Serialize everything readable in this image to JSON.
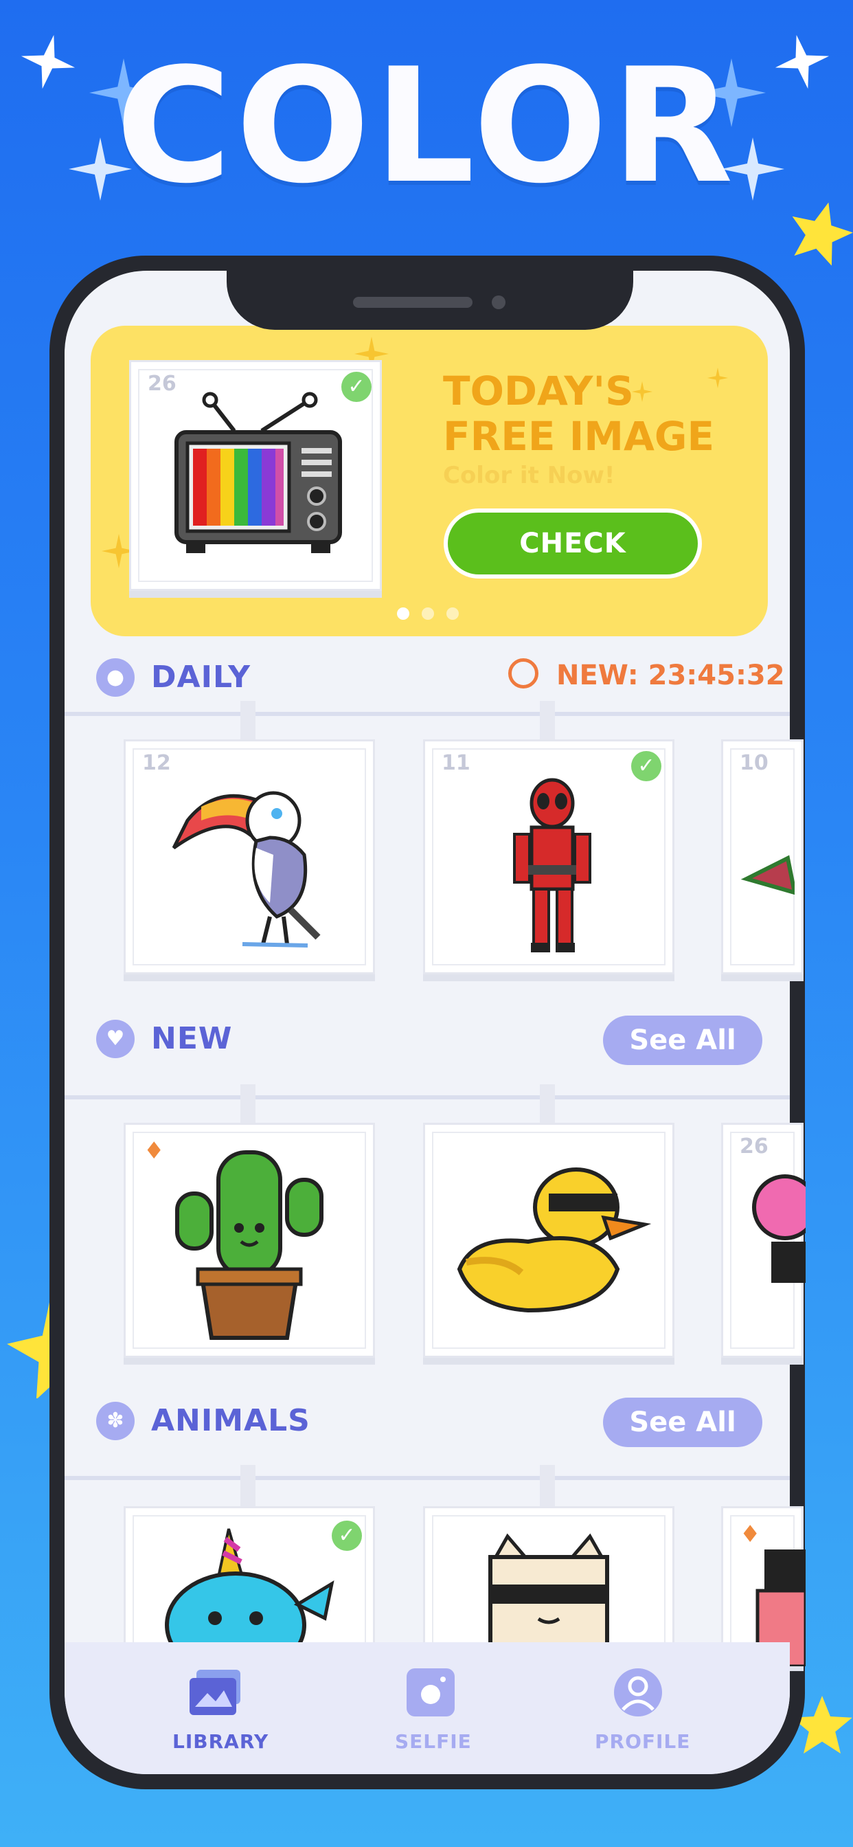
{
  "hero": {
    "title": "COLOR"
  },
  "banner": {
    "image_number": "26",
    "title_line1": "TODAY'S",
    "title_line2": "FREE IMAGE",
    "subtitle": "Color it Now!",
    "check_label": "CHECK",
    "page_dots": 3,
    "active_dot": 1
  },
  "daily": {
    "title": "DAILY",
    "timer": "NEW: 23:45:32",
    "cards": [
      {
        "num": "12",
        "subject": "toucan",
        "completed": false
      },
      {
        "num": "11",
        "subject": "deadpool",
        "completed": true
      },
      {
        "num": "10",
        "subject": "watermelon",
        "completed": false
      }
    ]
  },
  "new_section": {
    "title": "NEW",
    "see_all": "See All",
    "cards": [
      {
        "num": "",
        "subject": "cactus",
        "hot": true
      },
      {
        "num": "",
        "subject": "duck",
        "hot": false
      },
      {
        "num": "26",
        "subject": "flower",
        "hot": false
      }
    ]
  },
  "animals": {
    "title": "ANIMALS",
    "see_all": "See All",
    "cards": [
      {
        "subject": "narwhal",
        "completed": true
      },
      {
        "subject": "cat-with-sunglasses",
        "completed": false
      },
      {
        "subject": "partial",
        "hot": true
      }
    ]
  },
  "tabs": [
    {
      "label": "LIBRARY",
      "icon": "library-icon",
      "active": true
    },
    {
      "label": "SELFIE",
      "icon": "camera-icon",
      "active": false
    },
    {
      "label": "PROFILE",
      "icon": "profile-icon",
      "active": false
    }
  ],
  "colors": {
    "accent": "#5b63d6",
    "accent_light": "#a6abf1",
    "banner_bg": "#fde164",
    "check_green": "#5bbf1c",
    "timer_orange": "#ef7a3e"
  }
}
